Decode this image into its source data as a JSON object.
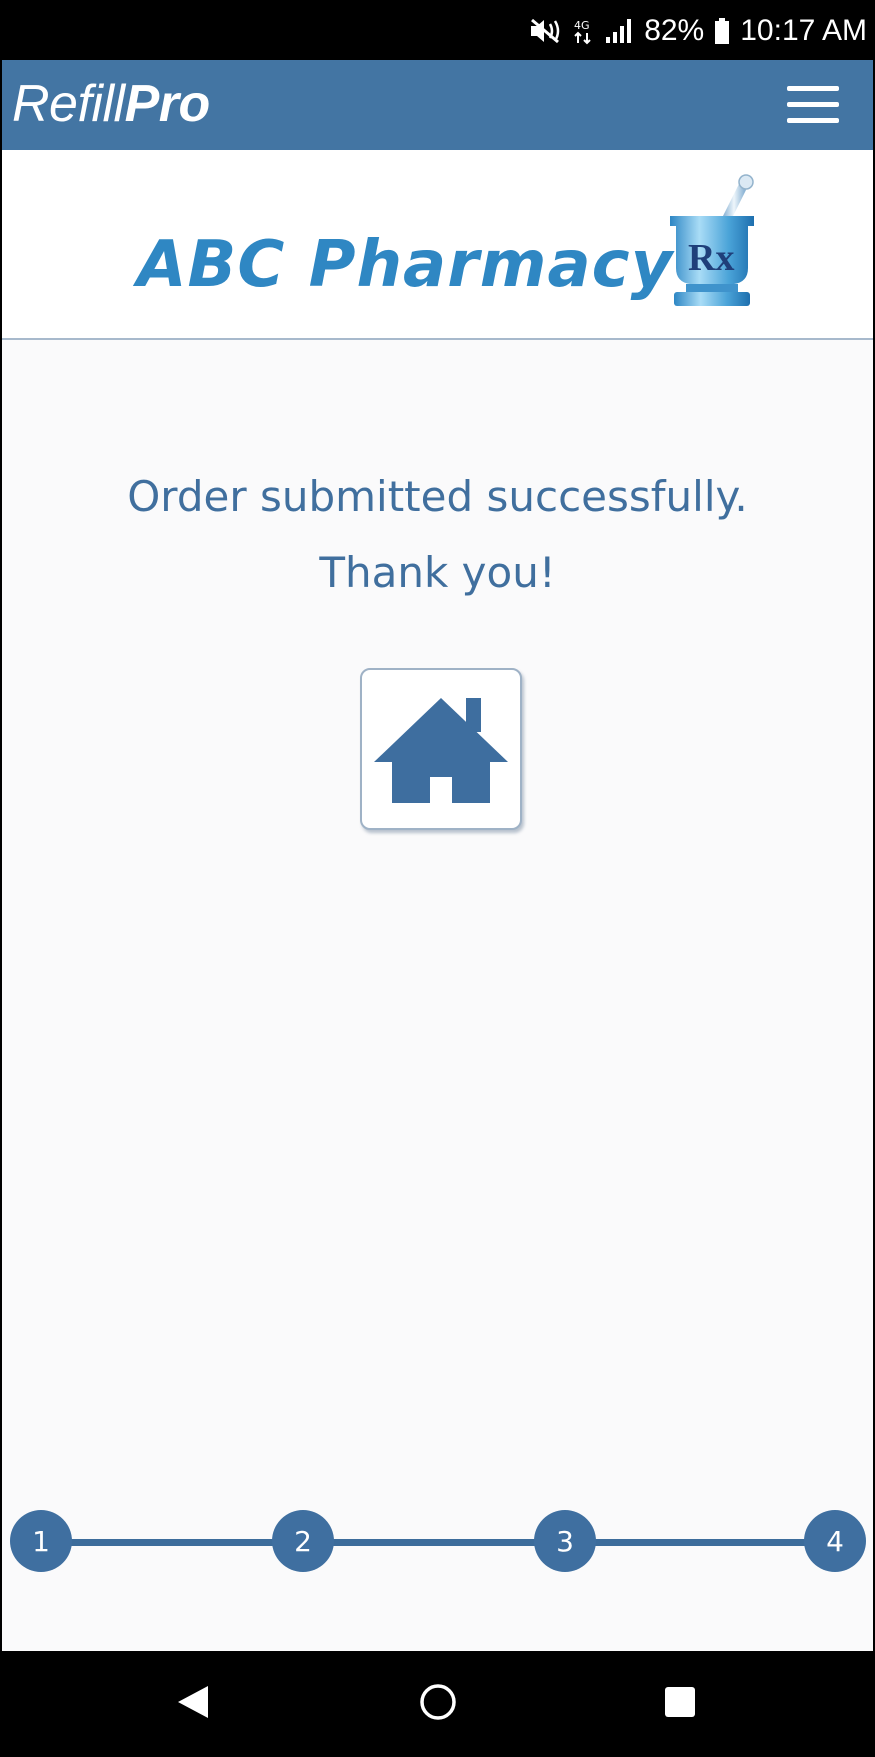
{
  "status_bar": {
    "icons": [
      "mute-vibrate-icon",
      "data-icon",
      "signal-icon",
      "battery-icon"
    ],
    "battery": "82%",
    "time": "10:17 AM"
  },
  "app_bar": {
    "brand_part1": "Refill",
    "brand_part2": "Pro",
    "menu_icon": "hamburger-menu-icon"
  },
  "pharmacy": {
    "name": "ABC Pharmacy",
    "logo_icon": "mortar-pestle-rx-icon",
    "logo_text": "Rx"
  },
  "message": {
    "line1": "Order submitted successfully.",
    "line2": "Thank you!"
  },
  "home_button": {
    "icon": "home-icon"
  },
  "stepper": {
    "steps": [
      "1",
      "2",
      "3",
      "4"
    ]
  },
  "nav_bar": {
    "icons": [
      "back-icon",
      "home-circle-icon",
      "recents-icon"
    ]
  },
  "colors": {
    "primary": "#4375a3",
    "brand_blue": "#2f87c3",
    "text_blue": "#406f9e",
    "background": "#fafafb"
  }
}
